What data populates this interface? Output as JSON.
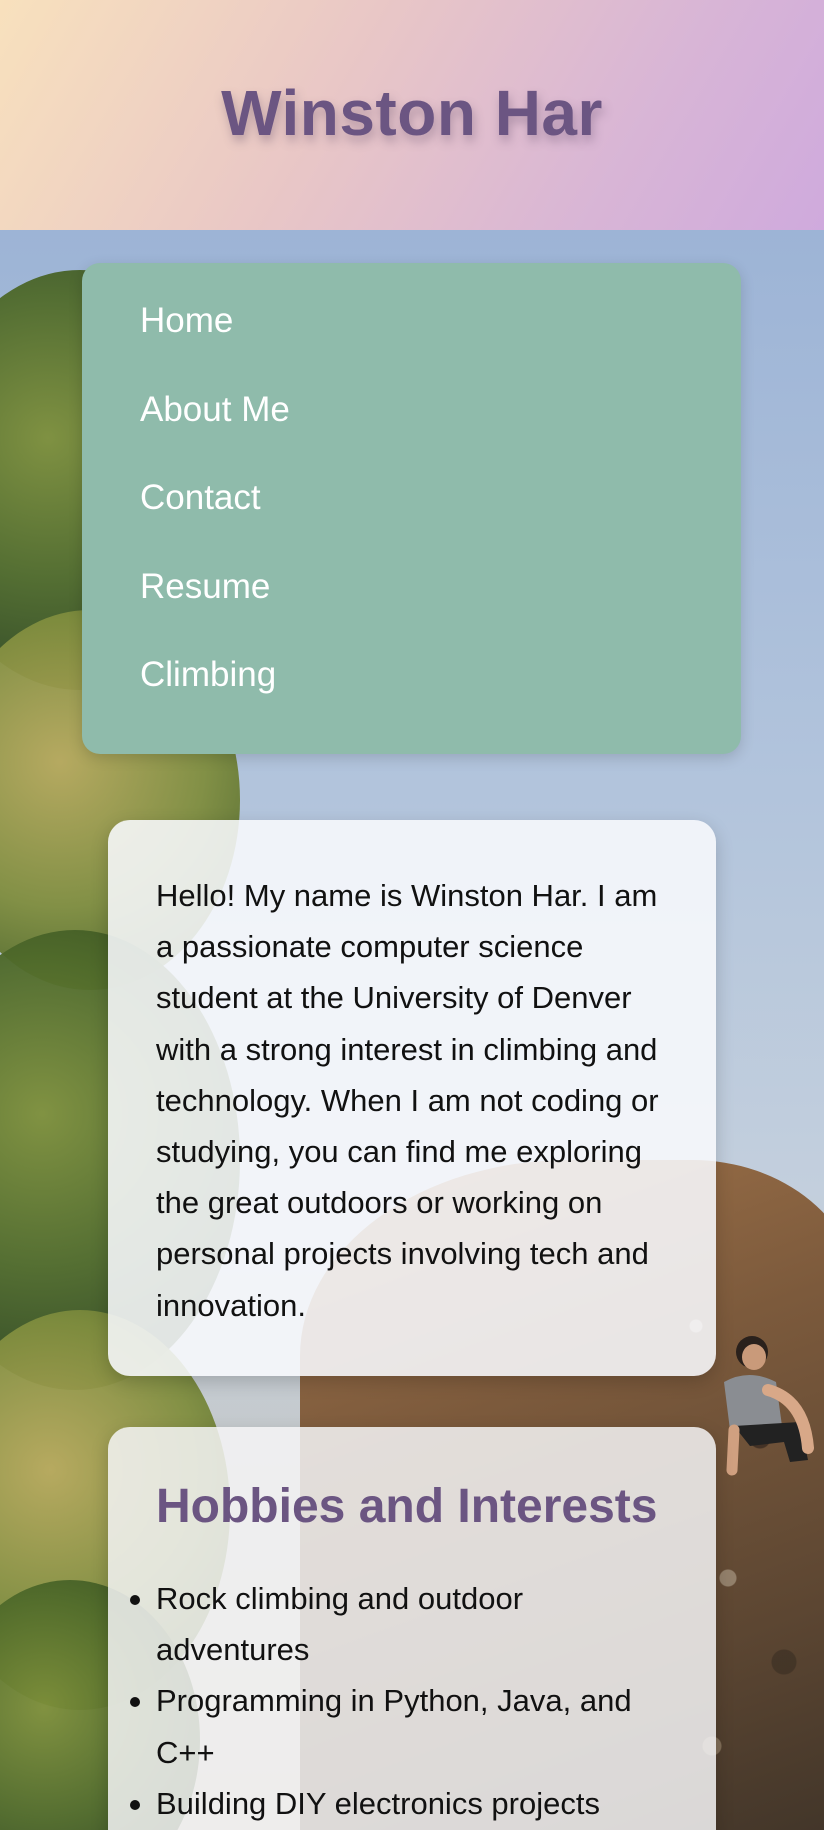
{
  "header": {
    "title": "Winston Har"
  },
  "nav": {
    "items": [
      {
        "label": "Home"
      },
      {
        "label": "About Me"
      },
      {
        "label": "Contact"
      },
      {
        "label": "Resume"
      },
      {
        "label": "Climbing"
      }
    ]
  },
  "about": {
    "text": "Hello! My name is Winston Har. I am a passionate computer science student at the University of Denver with a strong interest in climbing and technology. When I am not coding or studying, you can find me exploring the great outdoors or working on personal projects involving tech and innovation."
  },
  "hobbies": {
    "title": "Hobbies and Interests",
    "items": [
      "Rock climbing and outdoor adventures",
      "Programming in Python, Java, and C++",
      "Building DIY electronics projects"
    ]
  },
  "colors": {
    "title_purple": "#6b5582",
    "nav_green": "#8fbbab",
    "header_gradient_start": "#f8e1bd",
    "header_gradient_end": "#cfaadd"
  }
}
